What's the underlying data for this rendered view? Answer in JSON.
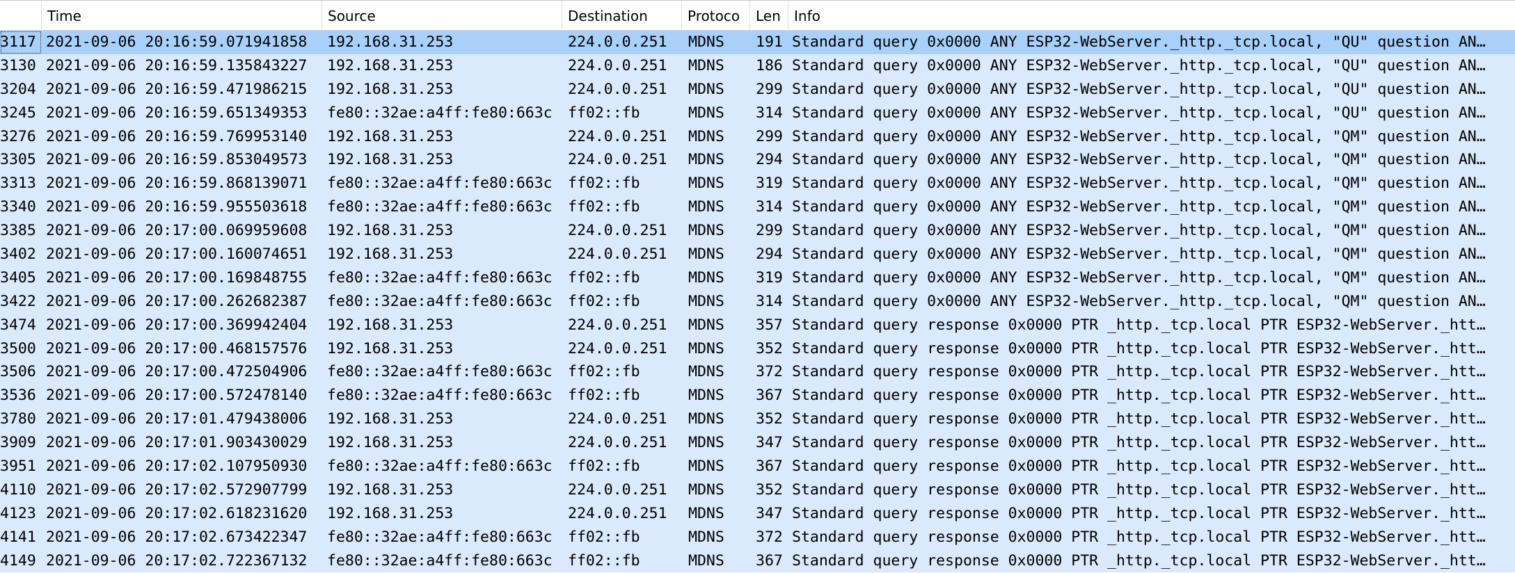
{
  "columns": {
    "no": "",
    "time": "Time",
    "source": "Source",
    "destination": "Destination",
    "protocol": "Protoco",
    "length": "Len",
    "info": "Info"
  },
  "packets": [
    {
      "no": "3117",
      "time": "2021-09-06 20:16:59.071941858",
      "source": "192.168.31.253",
      "destination": "224.0.0.251",
      "protocol": "MDNS",
      "length": "191",
      "info": "Standard query 0x0000 ANY ESP32-WebServer._http._tcp.local, \"QU\" question AN…"
    },
    {
      "no": "3130",
      "time": "2021-09-06 20:16:59.135843227",
      "source": "192.168.31.253",
      "destination": "224.0.0.251",
      "protocol": "MDNS",
      "length": "186",
      "info": "Standard query 0x0000 ANY ESP32-WebServer._http._tcp.local, \"QU\" question AN…"
    },
    {
      "no": "3204",
      "time": "2021-09-06 20:16:59.471986215",
      "source": "192.168.31.253",
      "destination": "224.0.0.251",
      "protocol": "MDNS",
      "length": "299",
      "info": "Standard query 0x0000 ANY ESP32-WebServer._http._tcp.local, \"QU\" question AN…"
    },
    {
      "no": "3245",
      "time": "2021-09-06 20:16:59.651349353",
      "source": "fe80::32ae:a4ff:fe80:663c",
      "destination": "ff02::fb",
      "protocol": "MDNS",
      "length": "314",
      "info": "Standard query 0x0000 ANY ESP32-WebServer._http._tcp.local, \"QU\" question AN…"
    },
    {
      "no": "3276",
      "time": "2021-09-06 20:16:59.769953140",
      "source": "192.168.31.253",
      "destination": "224.0.0.251",
      "protocol": "MDNS",
      "length": "299",
      "info": "Standard query 0x0000 ANY ESP32-WebServer._http._tcp.local, \"QM\" question AN…"
    },
    {
      "no": "3305",
      "time": "2021-09-06 20:16:59.853049573",
      "source": "192.168.31.253",
      "destination": "224.0.0.251",
      "protocol": "MDNS",
      "length": "294",
      "info": "Standard query 0x0000 ANY ESP32-WebServer._http._tcp.local, \"QM\" question AN…"
    },
    {
      "no": "3313",
      "time": "2021-09-06 20:16:59.868139071",
      "source": "fe80::32ae:a4ff:fe80:663c",
      "destination": "ff02::fb",
      "protocol": "MDNS",
      "length": "319",
      "info": "Standard query 0x0000 ANY ESP32-WebServer._http._tcp.local, \"QM\" question AN…"
    },
    {
      "no": "3340",
      "time": "2021-09-06 20:16:59.955503618",
      "source": "fe80::32ae:a4ff:fe80:663c",
      "destination": "ff02::fb",
      "protocol": "MDNS",
      "length": "314",
      "info": "Standard query 0x0000 ANY ESP32-WebServer._http._tcp.local, \"QM\" question AN…"
    },
    {
      "no": "3385",
      "time": "2021-09-06 20:17:00.069959608",
      "source": "192.168.31.253",
      "destination": "224.0.0.251",
      "protocol": "MDNS",
      "length": "299",
      "info": "Standard query 0x0000 ANY ESP32-WebServer._http._tcp.local, \"QM\" question AN…"
    },
    {
      "no": "3402",
      "time": "2021-09-06 20:17:00.160074651",
      "source": "192.168.31.253",
      "destination": "224.0.0.251",
      "protocol": "MDNS",
      "length": "294",
      "info": "Standard query 0x0000 ANY ESP32-WebServer._http._tcp.local, \"QM\" question AN…"
    },
    {
      "no": "3405",
      "time": "2021-09-06 20:17:00.169848755",
      "source": "fe80::32ae:a4ff:fe80:663c",
      "destination": "ff02::fb",
      "protocol": "MDNS",
      "length": "319",
      "info": "Standard query 0x0000 ANY ESP32-WebServer._http._tcp.local, \"QM\" question AN…"
    },
    {
      "no": "3422",
      "time": "2021-09-06 20:17:00.262682387",
      "source": "fe80::32ae:a4ff:fe80:663c",
      "destination": "ff02::fb",
      "protocol": "MDNS",
      "length": "314",
      "info": "Standard query 0x0000 ANY ESP32-WebServer._http._tcp.local, \"QM\" question AN…"
    },
    {
      "no": "3474",
      "time": "2021-09-06 20:17:00.369942404",
      "source": "192.168.31.253",
      "destination": "224.0.0.251",
      "protocol": "MDNS",
      "length": "357",
      "info": "Standard query response 0x0000 PTR _http._tcp.local PTR ESP32-WebServer._htt…"
    },
    {
      "no": "3500",
      "time": "2021-09-06 20:17:00.468157576",
      "source": "192.168.31.253",
      "destination": "224.0.0.251",
      "protocol": "MDNS",
      "length": "352",
      "info": "Standard query response 0x0000 PTR _http._tcp.local PTR ESP32-WebServer._htt…"
    },
    {
      "no": "3506",
      "time": "2021-09-06 20:17:00.472504906",
      "source": "fe80::32ae:a4ff:fe80:663c",
      "destination": "ff02::fb",
      "protocol": "MDNS",
      "length": "372",
      "info": "Standard query response 0x0000 PTR _http._tcp.local PTR ESP32-WebServer._htt…"
    },
    {
      "no": "3536",
      "time": "2021-09-06 20:17:00.572478140",
      "source": "fe80::32ae:a4ff:fe80:663c",
      "destination": "ff02::fb",
      "protocol": "MDNS",
      "length": "367",
      "info": "Standard query response 0x0000 PTR _http._tcp.local PTR ESP32-WebServer._htt…"
    },
    {
      "no": "3780",
      "time": "2021-09-06 20:17:01.479438006",
      "source": "192.168.31.253",
      "destination": "224.0.0.251",
      "protocol": "MDNS",
      "length": "352",
      "info": "Standard query response 0x0000 PTR _http._tcp.local PTR ESP32-WebServer._htt…"
    },
    {
      "no": "3909",
      "time": "2021-09-06 20:17:01.903430029",
      "source": "192.168.31.253",
      "destination": "224.0.0.251",
      "protocol": "MDNS",
      "length": "347",
      "info": "Standard query response 0x0000 PTR _http._tcp.local PTR ESP32-WebServer._htt…"
    },
    {
      "no": "3951",
      "time": "2021-09-06 20:17:02.107950930",
      "source": "fe80::32ae:a4ff:fe80:663c",
      "destination": "ff02::fb",
      "protocol": "MDNS",
      "length": "367",
      "info": "Standard query response 0x0000 PTR _http._tcp.local PTR ESP32-WebServer._htt…"
    },
    {
      "no": "4110",
      "time": "2021-09-06 20:17:02.572907799",
      "source": "192.168.31.253",
      "destination": "224.0.0.251",
      "protocol": "MDNS",
      "length": "352",
      "info": "Standard query response 0x0000 PTR _http._tcp.local PTR ESP32-WebServer._htt…"
    },
    {
      "no": "4123",
      "time": "2021-09-06 20:17:02.618231620",
      "source": "192.168.31.253",
      "destination": "224.0.0.251",
      "protocol": "MDNS",
      "length": "347",
      "info": "Standard query response 0x0000 PTR _http._tcp.local PTR ESP32-WebServer._htt…"
    },
    {
      "no": "4141",
      "time": "2021-09-06 20:17:02.673422347",
      "source": "fe80::32ae:a4ff:fe80:663c",
      "destination": "ff02::fb",
      "protocol": "MDNS",
      "length": "372",
      "info": "Standard query response 0x0000 PTR _http._tcp.local PTR ESP32-WebServer._htt…"
    },
    {
      "no": "4149",
      "time": "2021-09-06 20:17:02.722367132",
      "source": "fe80::32ae:a4ff:fe80:663c",
      "destination": "ff02::fb",
      "protocol": "MDNS",
      "length": "367",
      "info": "Standard query response 0x0000 PTR _http._tcp.local PTR ESP32-WebServer._htt…"
    }
  ],
  "selected_row": 0,
  "colors": {
    "row_background": "#dae9fb",
    "selected_background": "#a8d0f8"
  }
}
